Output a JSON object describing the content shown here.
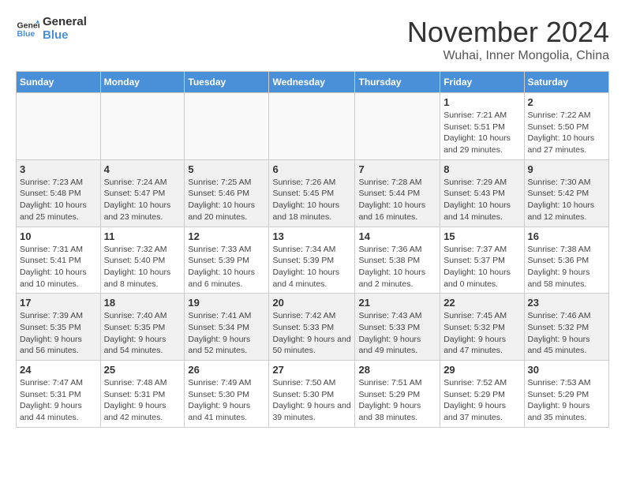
{
  "logo": {
    "line1": "General",
    "line2": "Blue"
  },
  "title": "November 2024",
  "location": "Wuhai, Inner Mongolia, China",
  "days_of_week": [
    "Sunday",
    "Monday",
    "Tuesday",
    "Wednesday",
    "Thursday",
    "Friday",
    "Saturday"
  ],
  "weeks": [
    [
      {
        "day": "",
        "info": ""
      },
      {
        "day": "",
        "info": ""
      },
      {
        "day": "",
        "info": ""
      },
      {
        "day": "",
        "info": ""
      },
      {
        "day": "",
        "info": ""
      },
      {
        "day": "1",
        "info": "Sunrise: 7:21 AM\nSunset: 5:51 PM\nDaylight: 10 hours and 29 minutes."
      },
      {
        "day": "2",
        "info": "Sunrise: 7:22 AM\nSunset: 5:50 PM\nDaylight: 10 hours and 27 minutes."
      }
    ],
    [
      {
        "day": "3",
        "info": "Sunrise: 7:23 AM\nSunset: 5:48 PM\nDaylight: 10 hours and 25 minutes."
      },
      {
        "day": "4",
        "info": "Sunrise: 7:24 AM\nSunset: 5:47 PM\nDaylight: 10 hours and 23 minutes."
      },
      {
        "day": "5",
        "info": "Sunrise: 7:25 AM\nSunset: 5:46 PM\nDaylight: 10 hours and 20 minutes."
      },
      {
        "day": "6",
        "info": "Sunrise: 7:26 AM\nSunset: 5:45 PM\nDaylight: 10 hours and 18 minutes."
      },
      {
        "day": "7",
        "info": "Sunrise: 7:28 AM\nSunset: 5:44 PM\nDaylight: 10 hours and 16 minutes."
      },
      {
        "day": "8",
        "info": "Sunrise: 7:29 AM\nSunset: 5:43 PM\nDaylight: 10 hours and 14 minutes."
      },
      {
        "day": "9",
        "info": "Sunrise: 7:30 AM\nSunset: 5:42 PM\nDaylight: 10 hours and 12 minutes."
      }
    ],
    [
      {
        "day": "10",
        "info": "Sunrise: 7:31 AM\nSunset: 5:41 PM\nDaylight: 10 hours and 10 minutes."
      },
      {
        "day": "11",
        "info": "Sunrise: 7:32 AM\nSunset: 5:40 PM\nDaylight: 10 hours and 8 minutes."
      },
      {
        "day": "12",
        "info": "Sunrise: 7:33 AM\nSunset: 5:39 PM\nDaylight: 10 hours and 6 minutes."
      },
      {
        "day": "13",
        "info": "Sunrise: 7:34 AM\nSunset: 5:39 PM\nDaylight: 10 hours and 4 minutes."
      },
      {
        "day": "14",
        "info": "Sunrise: 7:36 AM\nSunset: 5:38 PM\nDaylight: 10 hours and 2 minutes."
      },
      {
        "day": "15",
        "info": "Sunrise: 7:37 AM\nSunset: 5:37 PM\nDaylight: 10 hours and 0 minutes."
      },
      {
        "day": "16",
        "info": "Sunrise: 7:38 AM\nSunset: 5:36 PM\nDaylight: 9 hours and 58 minutes."
      }
    ],
    [
      {
        "day": "17",
        "info": "Sunrise: 7:39 AM\nSunset: 5:35 PM\nDaylight: 9 hours and 56 minutes."
      },
      {
        "day": "18",
        "info": "Sunrise: 7:40 AM\nSunset: 5:35 PM\nDaylight: 9 hours and 54 minutes."
      },
      {
        "day": "19",
        "info": "Sunrise: 7:41 AM\nSunset: 5:34 PM\nDaylight: 9 hours and 52 minutes."
      },
      {
        "day": "20",
        "info": "Sunrise: 7:42 AM\nSunset: 5:33 PM\nDaylight: 9 hours and 50 minutes."
      },
      {
        "day": "21",
        "info": "Sunrise: 7:43 AM\nSunset: 5:33 PM\nDaylight: 9 hours and 49 minutes."
      },
      {
        "day": "22",
        "info": "Sunrise: 7:45 AM\nSunset: 5:32 PM\nDaylight: 9 hours and 47 minutes."
      },
      {
        "day": "23",
        "info": "Sunrise: 7:46 AM\nSunset: 5:32 PM\nDaylight: 9 hours and 45 minutes."
      }
    ],
    [
      {
        "day": "24",
        "info": "Sunrise: 7:47 AM\nSunset: 5:31 PM\nDaylight: 9 hours and 44 minutes."
      },
      {
        "day": "25",
        "info": "Sunrise: 7:48 AM\nSunset: 5:31 PM\nDaylight: 9 hours and 42 minutes."
      },
      {
        "day": "26",
        "info": "Sunrise: 7:49 AM\nSunset: 5:30 PM\nDaylight: 9 hours and 41 minutes."
      },
      {
        "day": "27",
        "info": "Sunrise: 7:50 AM\nSunset: 5:30 PM\nDaylight: 9 hours and 39 minutes."
      },
      {
        "day": "28",
        "info": "Sunrise: 7:51 AM\nSunset: 5:29 PM\nDaylight: 9 hours and 38 minutes."
      },
      {
        "day": "29",
        "info": "Sunrise: 7:52 AM\nSunset: 5:29 PM\nDaylight: 9 hours and 37 minutes."
      },
      {
        "day": "30",
        "info": "Sunrise: 7:53 AM\nSunset: 5:29 PM\nDaylight: 9 hours and 35 minutes."
      }
    ]
  ]
}
